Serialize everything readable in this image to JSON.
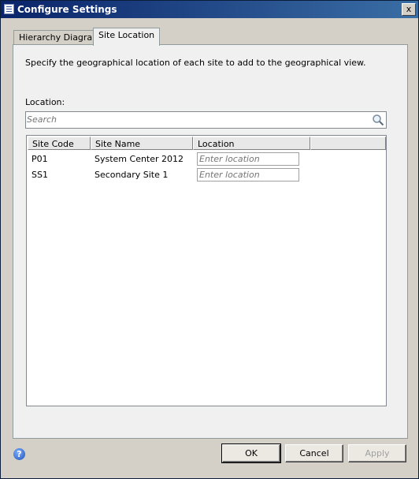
{
  "window": {
    "title": "Configure Settings",
    "close_glyph": "x"
  },
  "tabs": [
    {
      "label": "Hierarchy Diagram",
      "active": false
    },
    {
      "label": "Site Location",
      "active": true
    }
  ],
  "panel": {
    "description": "Specify the geographical location of each site to add to the geographical view.",
    "location_label": "Location:",
    "search": {
      "placeholder": "Search",
      "value": "",
      "icon": "search-icon"
    }
  },
  "grid": {
    "columns": [
      "Site Code",
      "Site Name",
      "Location",
      ""
    ],
    "rows": [
      {
        "site_code": "P01",
        "site_name": "System Center 2012...",
        "location_placeholder": "Enter location"
      },
      {
        "site_code": "SS1",
        "site_name": "Secondary Site 1",
        "location_placeholder": "Enter location"
      }
    ]
  },
  "footer": {
    "help_glyph": "?",
    "ok_label": "OK",
    "cancel_label": "Cancel",
    "apply_label": "Apply",
    "apply_enabled": false
  },
  "colors": {
    "titlebar_start": "#0a246a",
    "titlebar_end": "#3a6ea5",
    "dialog_bg": "#d4d0c8"
  }
}
